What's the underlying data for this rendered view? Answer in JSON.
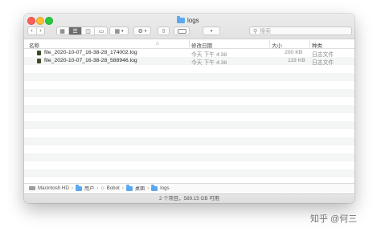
{
  "window": {
    "title": "logs"
  },
  "toolbar": {
    "back_icon": "chevron-left",
    "forward_icon": "chevron-right",
    "search_placeholder": "搜索"
  },
  "columns": {
    "name": "名称",
    "date": "修改日期",
    "size": "大小",
    "kind": "种类"
  },
  "files": [
    {
      "name": "file_2020-10-07_16-38-28_174002.log",
      "date": "今天 下午 4:38",
      "size": "200 KB",
      "kind": "日志文件"
    },
    {
      "name": "file_2020-10-07_16-38-28_588946.log",
      "date": "今天 下午 4:38",
      "size": "119 KB",
      "kind": "日志文件"
    }
  ],
  "pathbar": {
    "items": [
      "Macintosh HD",
      "用户",
      "Bobot",
      "桌面",
      "logs"
    ]
  },
  "status": {
    "text": "2 个项目，589.15 GB 可用"
  },
  "watermark": "知乎 @何三"
}
